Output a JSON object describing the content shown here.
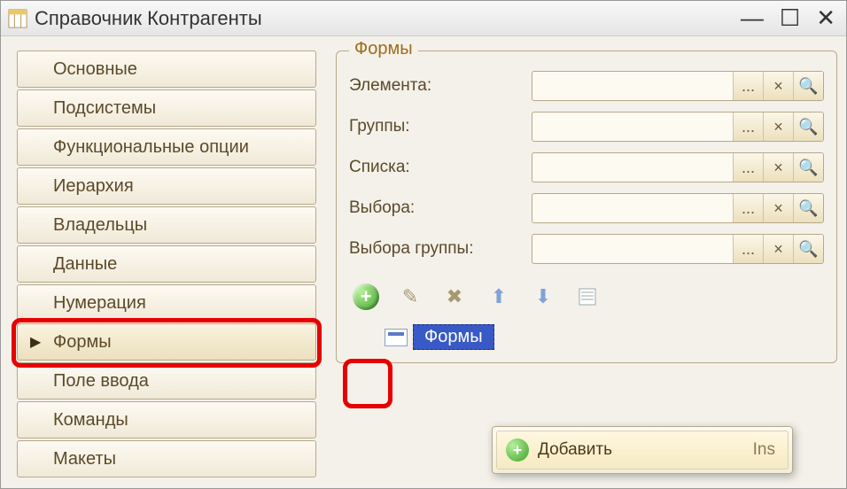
{
  "window": {
    "title": "Справочник Контрагенты"
  },
  "sidebar": {
    "items": [
      {
        "label": "Основные"
      },
      {
        "label": "Подсистемы"
      },
      {
        "label": "Функциональные опции"
      },
      {
        "label": "Иерархия"
      },
      {
        "label": "Владельцы"
      },
      {
        "label": "Данные"
      },
      {
        "label": "Нумерация"
      },
      {
        "label": "Формы"
      },
      {
        "label": "Поле ввода"
      },
      {
        "label": "Команды"
      },
      {
        "label": "Макеты"
      }
    ]
  },
  "forms_group": {
    "title": "Формы",
    "rows": [
      {
        "label": "Элемента:",
        "value": ""
      },
      {
        "label": "Группы:",
        "value": ""
      },
      {
        "label": "Списка:",
        "value": ""
      },
      {
        "label": "Выбора:",
        "value": ""
      },
      {
        "label": "Выбора группы:",
        "value": ""
      }
    ],
    "buttons": {
      "ellipsis": "...",
      "clear": "×",
      "search": "🔍"
    }
  },
  "item_badge": "Формы",
  "context_menu": {
    "add_label": "Добавить",
    "add_shortcut": "Ins"
  }
}
